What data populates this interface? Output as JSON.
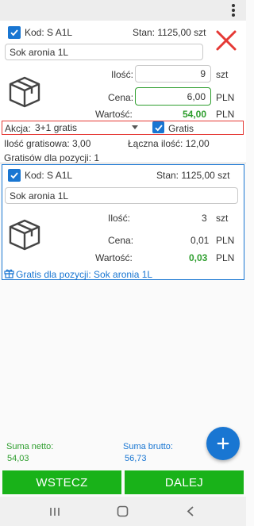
{
  "colors": {
    "primary": "#1976d2",
    "accent_green": "#19b219",
    "value_green": "#2e9e2e",
    "delete_red": "#e53935"
  },
  "item1": {
    "code_label": "Kod: S A1L",
    "stock_label": "Stan: 1125,00 szt",
    "name_value": "Sok aronia 1L",
    "qty_label": "Ilość:",
    "qty_value": "9",
    "qty_unit": "szt",
    "price_label": "Cena:",
    "price_value": "6,00",
    "price_unit": "PLN",
    "value_label": "Wartość:",
    "value_value": "54,00",
    "value_unit": "PLN",
    "action_label": "Akcja:",
    "action_value": "3+1 gratis",
    "gratis_label": "Gratis",
    "free_qty_label": "Ilość gratisowa: 3,00",
    "total_qty_label": "Łączna ilość: 12,00",
    "free_count_label": "Gratisów dla pozycji: 1"
  },
  "item2": {
    "code_label": "Kod: S A1L",
    "stock_label": "Stan: 1125,00 szt",
    "name_value": "Sok aronia 1L",
    "qty_label": "Ilość:",
    "qty_value": "3",
    "qty_unit": "szt",
    "price_label": "Cena:",
    "price_value": "0,01",
    "price_unit": "PLN",
    "value_label": "Wartość:",
    "value_value": "0,03",
    "value_unit": "PLN",
    "gift_label": "Gratis dla pozycji: Sok aronia 1L"
  },
  "summary": {
    "net_label": "Suma netto:",
    "net_value": "54,03",
    "gross_label": "Suma brutto:",
    "gross_value": "56,73"
  },
  "buttons": {
    "back": "WSTECZ",
    "next": "DALEJ"
  },
  "icons": [
    "more-vert-icon",
    "close-icon",
    "box-icon",
    "gift-icon",
    "add-icon",
    "nav-recents-icon",
    "nav-home-icon",
    "nav-back-icon"
  ]
}
